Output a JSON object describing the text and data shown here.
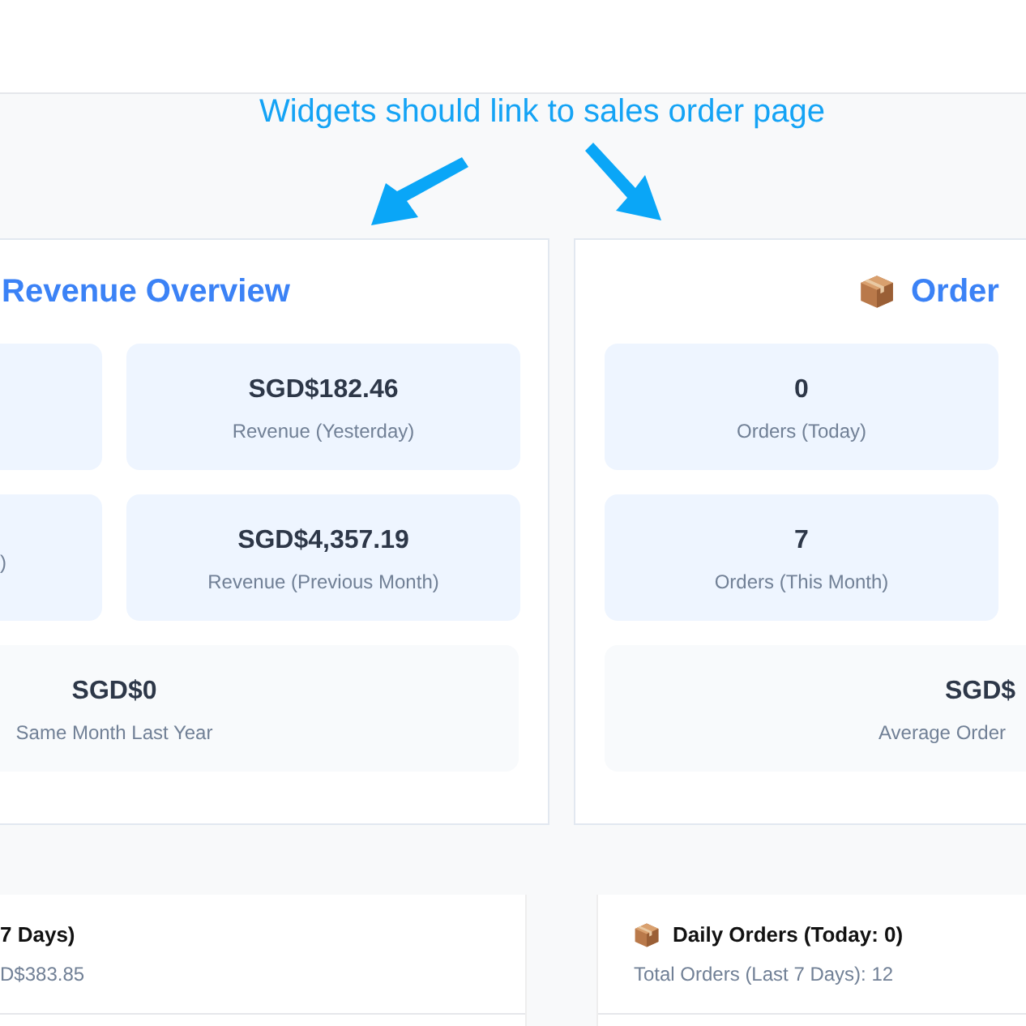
{
  "annotation": {
    "text": "Widgets should link to sales order page"
  },
  "cards": [
    {
      "title": "Revenue Overview",
      "has_icon": false,
      "tiles": [
        {
          "kind": "blank"
        },
        {
          "kind": "full",
          "value": "SGD$182.46",
          "label": "Revenue (Yesterday)"
        },
        {
          "kind": "clipped",
          "label": ")"
        },
        {
          "kind": "full",
          "value": "SGD$4,357.19",
          "label": "Revenue (Previous Month)"
        }
      ],
      "summary": {
        "value": "SGD$0",
        "label": "Same Month Last Year"
      }
    },
    {
      "title": "Order",
      "has_icon": true,
      "tiles": [
        {
          "kind": "full",
          "value": "0",
          "label": "Orders (Today)"
        },
        {
          "kind": "full",
          "value": "7",
          "label": "Orders (This Month)"
        }
      ],
      "summary": {
        "value": "SGD$",
        "label": "Average Order"
      }
    }
  ],
  "panels": [
    {
      "title": "7 Days)",
      "has_icon": false,
      "subtitle": "D$383.85"
    },
    {
      "title": "Daily Orders (Today: 0)",
      "has_icon": true,
      "subtitle": "Total Orders (Last 7 Days): 12"
    }
  ]
}
